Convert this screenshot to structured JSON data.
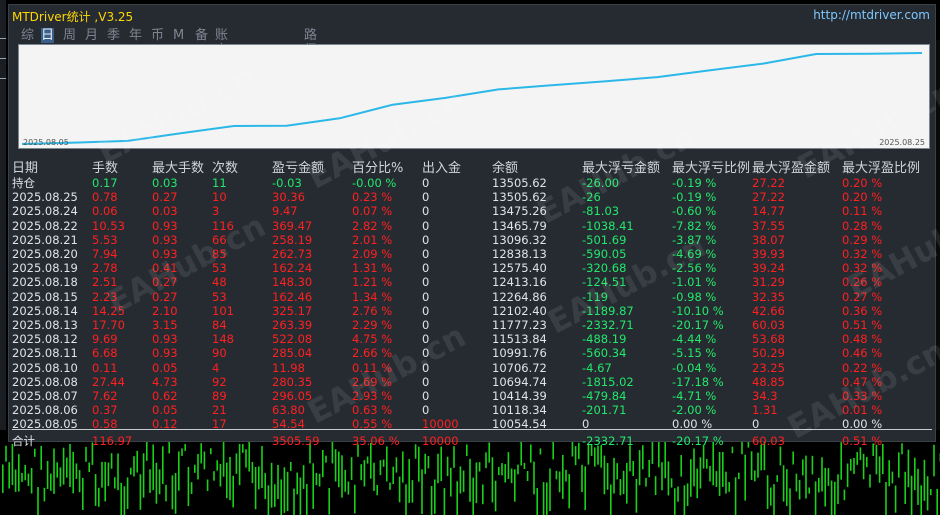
{
  "app": {
    "title": "MTDriver统计 ,V3.25",
    "link": "http://mtdriver.com",
    "watermark": "EAHub.cn"
  },
  "tabs": [
    {
      "label": "综",
      "active": false
    },
    {
      "label": "日",
      "active": true
    },
    {
      "label": "周",
      "active": false
    },
    {
      "label": "月",
      "active": false
    },
    {
      "label": "季",
      "active": false
    },
    {
      "label": "年",
      "active": false
    },
    {
      "label": "币",
      "active": false
    },
    {
      "label": "M",
      "active": false
    },
    {
      "label": "备",
      "active": false
    },
    {
      "label": "账户",
      "active": false
    },
    {
      "label": "路径",
      "active": false
    }
  ],
  "chart": {
    "start_date": "2025.08.05",
    "end_date": "2025.08.25",
    "line_color": "#2bb8e8"
  },
  "columns": [
    "日期",
    "手数",
    "最大手数",
    "次数",
    "盈亏金额",
    "百分比%",
    "出入金",
    "余额",
    "最大浮亏金额",
    "最大浮亏比例",
    "最大浮盈金额",
    "最大浮盈比例"
  ],
  "rows": [
    {
      "date": "持仓",
      "lots": "0.17",
      "max_lots": "0.03",
      "count": "11",
      "pnl": "-0.03",
      "pct": "-0.00 %",
      "flow": "0",
      "balance": "13505.62",
      "max_float_loss": "-26.00",
      "max_float_loss_pct": "-0.19 %",
      "max_float_profit": "27.22",
      "max_float_profit_pct": "0.20 %",
      "kind": "open"
    },
    {
      "date": "2025.08.25",
      "lots": "0.78",
      "max_lots": "0.27",
      "count": "10",
      "pnl": "30.36",
      "pct": "0.23 %",
      "flow": "0",
      "balance": "13505.62",
      "max_float_loss": "-26",
      "max_float_loss_pct": "-0.19 %",
      "max_float_profit": "27.22",
      "max_float_profit_pct": "0.20 %",
      "kind": "day"
    },
    {
      "date": "2025.08.24",
      "lots": "0.06",
      "max_lots": "0.03",
      "count": "3",
      "pnl": "9.47",
      "pct": "0.07 %",
      "flow": "0",
      "balance": "13475.26",
      "max_float_loss": "-81.03",
      "max_float_loss_pct": "-0.60 %",
      "max_float_profit": "14.77",
      "max_float_profit_pct": "0.11 %",
      "kind": "day"
    },
    {
      "date": "2025.08.22",
      "lots": "10.53",
      "max_lots": "0.93",
      "count": "116",
      "pnl": "369.47",
      "pct": "2.82 %",
      "flow": "0",
      "balance": "13465.79",
      "max_float_loss": "-1038.41",
      "max_float_loss_pct": "-7.82 %",
      "max_float_profit": "37.55",
      "max_float_profit_pct": "0.28 %",
      "kind": "day"
    },
    {
      "date": "2025.08.21",
      "lots": "5.53",
      "max_lots": "0.93",
      "count": "66",
      "pnl": "258.19",
      "pct": "2.01 %",
      "flow": "0",
      "balance": "13096.32",
      "max_float_loss": "-501.69",
      "max_float_loss_pct": "-3.87 %",
      "max_float_profit": "38.07",
      "max_float_profit_pct": "0.29 %",
      "kind": "day"
    },
    {
      "date": "2025.08.20",
      "lots": "7.94",
      "max_lots": "0.93",
      "count": "85",
      "pnl": "262.73",
      "pct": "2.09 %",
      "flow": "0",
      "balance": "12838.13",
      "max_float_loss": "-590.05",
      "max_float_loss_pct": "-4.69 %",
      "max_float_profit": "39.93",
      "max_float_profit_pct": "0.32 %",
      "kind": "day"
    },
    {
      "date": "2025.08.19",
      "lots": "2.78",
      "max_lots": "0.41",
      "count": "53",
      "pnl": "162.24",
      "pct": "1.31 %",
      "flow": "0",
      "balance": "12575.40",
      "max_float_loss": "-320.68",
      "max_float_loss_pct": "-2.56 %",
      "max_float_profit": "39.24",
      "max_float_profit_pct": "0.32 %",
      "kind": "day"
    },
    {
      "date": "2025.08.18",
      "lots": "2.51",
      "max_lots": "0.27",
      "count": "48",
      "pnl": "148.30",
      "pct": "1.21 %",
      "flow": "0",
      "balance": "12413.16",
      "max_float_loss": "-124.51",
      "max_float_loss_pct": "-1.01 %",
      "max_float_profit": "31.29",
      "max_float_profit_pct": "0.26 %",
      "kind": "day"
    },
    {
      "date": "2025.08.15",
      "lots": "2.23",
      "max_lots": "0.27",
      "count": "53",
      "pnl": "162.46",
      "pct": "1.34 %",
      "flow": "0",
      "balance": "12264.86",
      "max_float_loss": "-119",
      "max_float_loss_pct": "-0.98 %",
      "max_float_profit": "32.35",
      "max_float_profit_pct": "0.27 %",
      "kind": "day"
    },
    {
      "date": "2025.08.14",
      "lots": "14.25",
      "max_lots": "2.10",
      "count": "101",
      "pnl": "325.17",
      "pct": "2.76 %",
      "flow": "0",
      "balance": "12102.40",
      "max_float_loss": "-1189.87",
      "max_float_loss_pct": "-10.10 %",
      "max_float_profit": "42.66",
      "max_float_profit_pct": "0.36 %",
      "kind": "day"
    },
    {
      "date": "2025.08.13",
      "lots": "17.70",
      "max_lots": "3.15",
      "count": "84",
      "pnl": "263.39",
      "pct": "2.29 %",
      "flow": "0",
      "balance": "11777.23",
      "max_float_loss": "-2332.71",
      "max_float_loss_pct": "-20.17 %",
      "max_float_profit": "60.03",
      "max_float_profit_pct": "0.51 %",
      "kind": "day"
    },
    {
      "date": "2025.08.12",
      "lots": "9.69",
      "max_lots": "0.93",
      "count": "148",
      "pnl": "522.08",
      "pct": "4.75 %",
      "flow": "0",
      "balance": "11513.84",
      "max_float_loss": "-488.19",
      "max_float_loss_pct": "-4.44 %",
      "max_float_profit": "53.68",
      "max_float_profit_pct": "0.48 %",
      "kind": "day"
    },
    {
      "date": "2025.08.11",
      "lots": "6.68",
      "max_lots": "0.93",
      "count": "90",
      "pnl": "285.04",
      "pct": "2.66 %",
      "flow": "0",
      "balance": "10991.76",
      "max_float_loss": "-560.34",
      "max_float_loss_pct": "-5.15 %",
      "max_float_profit": "50.29",
      "max_float_profit_pct": "0.46 %",
      "kind": "day"
    },
    {
      "date": "2025.08.10",
      "lots": "0.11",
      "max_lots": "0.05",
      "count": "4",
      "pnl": "11.98",
      "pct": "0.11 %",
      "flow": "0",
      "balance": "10706.72",
      "max_float_loss": "-4.67",
      "max_float_loss_pct": "-0.04 %",
      "max_float_profit": "23.25",
      "max_float_profit_pct": "0.22 %",
      "kind": "day"
    },
    {
      "date": "2025.08.08",
      "lots": "27.44",
      "max_lots": "4.73",
      "count": "92",
      "pnl": "280.35",
      "pct": "2.69 %",
      "flow": "0",
      "balance": "10694.74",
      "max_float_loss": "-1815.02",
      "max_float_loss_pct": "-17.18 %",
      "max_float_profit": "48.85",
      "max_float_profit_pct": "0.47 %",
      "kind": "day"
    },
    {
      "date": "2025.08.07",
      "lots": "7.62",
      "max_lots": "0.62",
      "count": "89",
      "pnl": "296.05",
      "pct": "2.93 %",
      "flow": "0",
      "balance": "10414.39",
      "max_float_loss": "-479.84",
      "max_float_loss_pct": "-4.71 %",
      "max_float_profit": "34.3",
      "max_float_profit_pct": "0.33 %",
      "kind": "day"
    },
    {
      "date": "2025.08.06",
      "lots": "0.37",
      "max_lots": "0.05",
      "count": "21",
      "pnl": "63.80",
      "pct": "0.63 %",
      "flow": "0",
      "balance": "10118.34",
      "max_float_loss": "-201.71",
      "max_float_loss_pct": "-2.00 %",
      "max_float_profit": "1.31",
      "max_float_profit_pct": "0.01 %",
      "kind": "day"
    },
    {
      "date": "2025.08.05",
      "lots": "0.58",
      "max_lots": "0.12",
      "count": "17",
      "pnl": "54.54",
      "pct": "0.55 %",
      "flow": "10000",
      "balance": "10054.54",
      "max_float_loss": "0",
      "max_float_loss_pct": "0.00 %",
      "max_float_profit": "0",
      "max_float_profit_pct": "0.00 %",
      "kind": "day"
    },
    {
      "date": "合计",
      "lots": "116.97",
      "max_lots": "",
      "count": "",
      "pnl": "3505.59",
      "pct": "35.06 %",
      "flow": "10000",
      "balance": "",
      "max_float_loss": "-2332.71",
      "max_float_loss_pct": "-20.17 %",
      "max_float_profit": "60.03",
      "max_float_profit_pct": "0.51 %",
      "kind": "total"
    }
  ],
  "colors": {
    "title": "#ffd700",
    "link": "#7ec8ff",
    "header": "#d0d5da",
    "date": "#e0e4e8",
    "profit": "#ff2020",
    "loss": "#22e86a",
    "neutral": "#e0e4e8",
    "open_green": "#22e86a",
    "candle": "#19d119"
  }
}
